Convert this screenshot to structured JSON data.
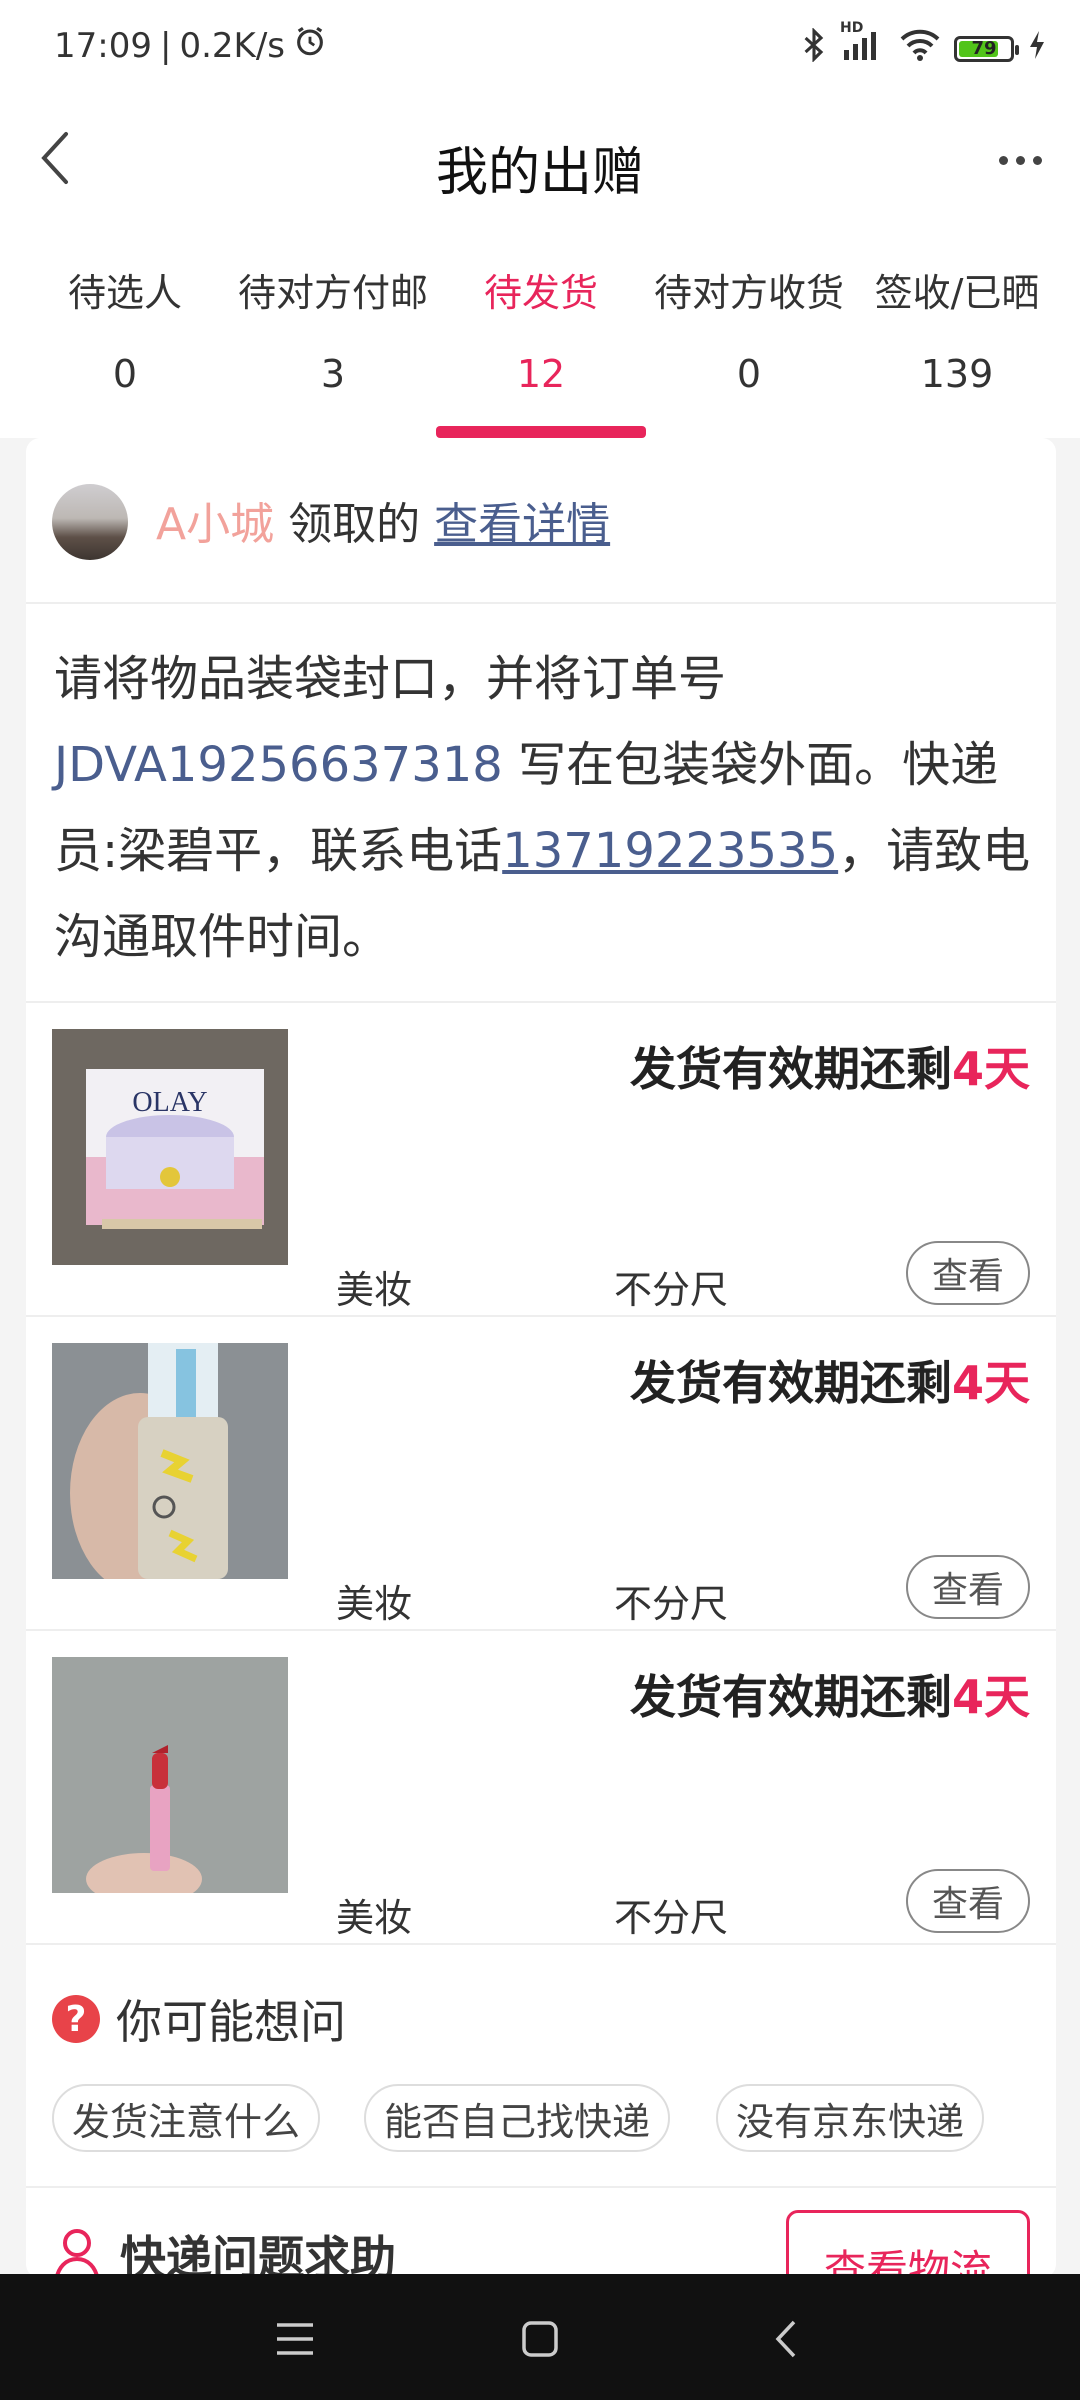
{
  "status_bar": {
    "time": "17:09",
    "separator": "|",
    "speed": "0.2K/s",
    "icons": [
      "alarm-icon",
      "bluetooth-icon",
      "signal-icon",
      "wifi-icon",
      "battery-icon",
      "charging-icon"
    ],
    "signal_label": "HD",
    "battery_level": "79"
  },
  "header": {
    "title": "我的出赠",
    "back_icon": "chevron-left-icon",
    "more_icon": "more-horizontal-icon"
  },
  "tabs": [
    {
      "label": "待选人",
      "count": "0",
      "active": false
    },
    {
      "label": "待对方付邮",
      "count": "3",
      "active": false
    },
    {
      "label": "待发货",
      "count": "12",
      "active": true
    },
    {
      "label": "待对方收货",
      "count": "0",
      "active": false
    },
    {
      "label": "签收/已晒",
      "count": "139",
      "active": false
    }
  ],
  "claim": {
    "name": "A小城",
    "suffix": "领取的",
    "detail_link": "查看详情"
  },
  "instruction": {
    "part1": "请将物品装袋封口，并将订单号 ",
    "order_number": "JDVA19256637318",
    "part2": " 写在包装袋外面。快递员:梁碧平，联系电话",
    "phone": "13719223535",
    "part3": "，请致电沟通取件时间。"
  },
  "items": [
    {
      "deadline_prefix": "发货有效期还剩",
      "deadline_days": "4天",
      "category": "美妆",
      "size": "不分尺",
      "view_label": "查看",
      "thumb_text": "OLAY"
    },
    {
      "deadline_prefix": "发货有效期还剩",
      "deadline_days": "4天",
      "category": "美妆",
      "size": "不分尺",
      "view_label": "查看"
    },
    {
      "deadline_prefix": "发货有效期还剩",
      "deadline_days": "4天",
      "category": "美妆",
      "size": "不分尺",
      "view_label": "查看"
    }
  ],
  "faq": {
    "icon_text": "?",
    "title": "你可能想问",
    "questions": [
      "发货注意什么",
      "能否自己找快递",
      "没有京东快递"
    ]
  },
  "help": {
    "title": "快递问题求助",
    "button": "查看物流"
  },
  "colors": {
    "accent": "#e8255b",
    "link": "#4a5e8e",
    "claimer_name": "#f2a29b"
  }
}
